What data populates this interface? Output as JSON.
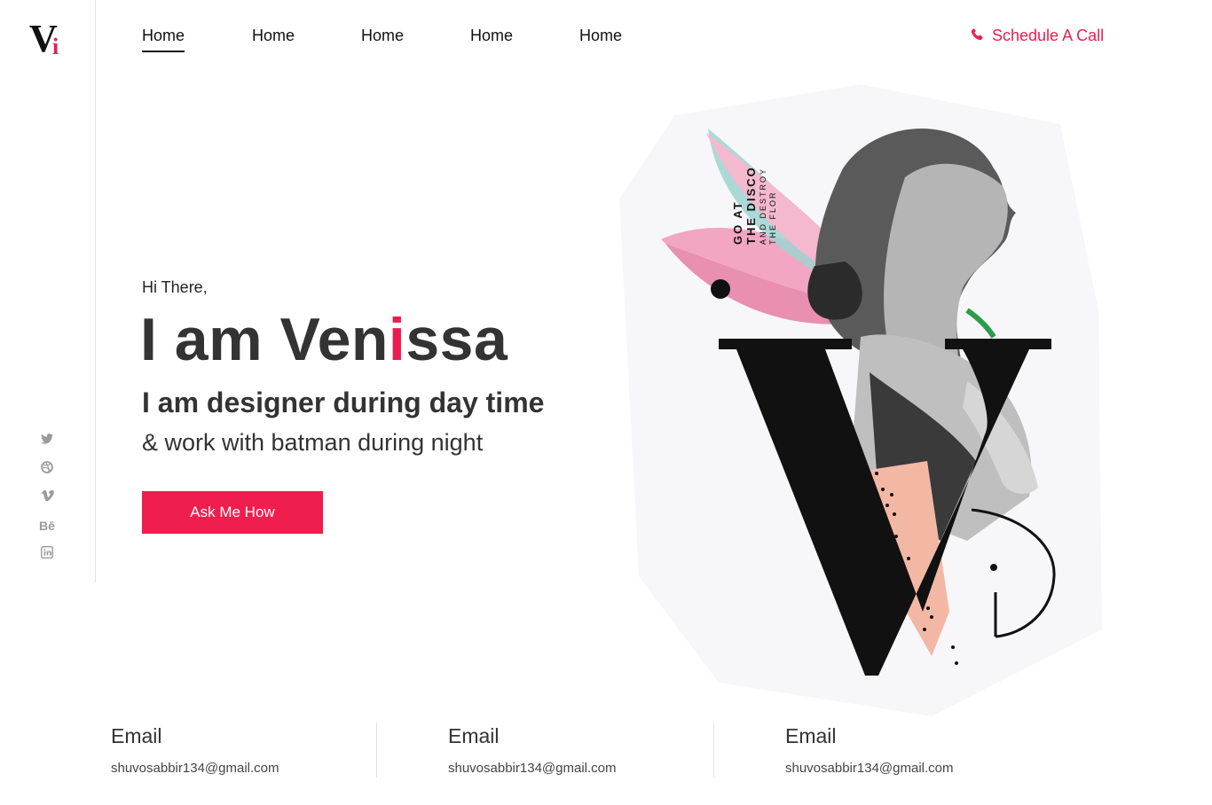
{
  "brand": {
    "logo_main": "V",
    "logo_accent": "i",
    "accent_color": "#e91e4f"
  },
  "nav": {
    "items": [
      {
        "label": "Home",
        "active": true
      },
      {
        "label": "Home",
        "active": false
      },
      {
        "label": "Home",
        "active": false
      },
      {
        "label": "Home",
        "active": false
      },
      {
        "label": "Home",
        "active": false
      }
    ],
    "call_label": "Schedule A Call",
    "call_icon": "phone-icon"
  },
  "hero": {
    "greeting": "Hi There,",
    "name_prefix": "I am Ven",
    "name_accent": "i",
    "name_suffix": "ssa",
    "tagline_1": "I am designer during day time",
    "tagline_2": "& work with batman during night",
    "cta_label": "Ask Me How",
    "poster_line_1": "GO AT",
    "poster_line_2": "THE DISCO",
    "poster_line_3": "AND DESTROY",
    "poster_line_4": "THE FLOR"
  },
  "social": [
    {
      "icon": "twitter-icon",
      "glyph": "t"
    },
    {
      "icon": "dribbble-icon",
      "glyph": "◍"
    },
    {
      "icon": "vimeo-icon",
      "glyph": "v"
    },
    {
      "icon": "behance-icon",
      "glyph": "Bē"
    },
    {
      "icon": "linkedin-icon",
      "glyph": "in"
    }
  ],
  "contacts": [
    {
      "title": "Email",
      "value": "shuvosabbir134@gmail.com"
    },
    {
      "title": "Email",
      "value": "shuvosabbir134@gmail.com"
    },
    {
      "title": "Email",
      "value": "shuvosabbir134@gmail.com"
    }
  ]
}
